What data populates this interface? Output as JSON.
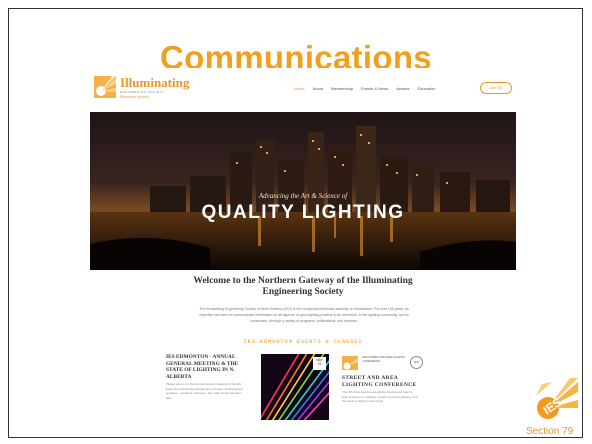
{
  "slide": {
    "title": "Communications",
    "section": "Section 79"
  },
  "site": {
    "logo": {
      "name": "Illuminating",
      "subtitle": "ENGINEERING SOCIETY",
      "chapter": "Edmonton Section"
    },
    "nav": {
      "items": [
        "Home",
        "About",
        "Membership",
        "Events & News",
        "Awards",
        "Education"
      ],
      "active": "Home",
      "button_label": "Join IES"
    },
    "hero": {
      "kicker": "Advancing the Art & Science of",
      "headline": "QUALITY LIGHTING"
    },
    "welcome": {
      "heading": "Welcome to the Northern Gateway of the Illuminating Engineering Society",
      "intro": "The Illuminating Engineering Society of North America (IES) is the recognized technical authority on illumination. For over 100 years, its objective has been to communicate information on all aspects of good lighting practice to its members, to the lighting community, and to consumers, through a variety of programs, publications, and services."
    },
    "events": {
      "heading": "IES EDMONTON EVENTS & CLASSES",
      "card1": {
        "title": "IES EDMONTON - ANNUAL GENERAL MEETING & THE STATE OF LIGHTING IN N. ALBERTA",
        "text": "Please join us for the Annual General Meeting of the IES Edmonton Illuminating Engineering Society. Distinguished speakers, members' welcome. Tour with a brief reception after."
      },
      "card2": {
        "date_month": "MAY",
        "date_day": "21"
      },
      "card3": {
        "banner_text": "2022 STREET AND AREA LIGHTING CONFERENCE",
        "badge": "IES",
        "title": "STREET AND AREA LIGHTING CONFERENCE",
        "text": "The IES Street and Area Lighting Conference returns with sessions on roadway, outdoor and area lighting, and the latest in lighting technology."
      }
    }
  },
  "colors": {
    "accent": "#f0a020",
    "brand": "#e8962a",
    "text_dark": "#333333"
  }
}
